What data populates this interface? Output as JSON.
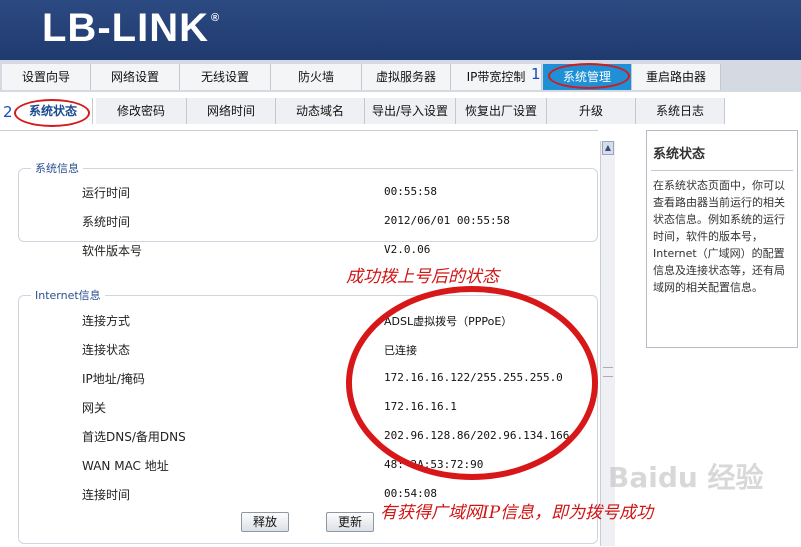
{
  "header": {
    "logo_text": "LB-LINK",
    "logo_mark": "®"
  },
  "top_nav": {
    "tabs": [
      "设置向导",
      "网络设置",
      "无线设置",
      "防火墙",
      "虚拟服务器",
      "IP带宽控制",
      "系统管理",
      "重启路由器"
    ],
    "active": "系统管理",
    "annotation_step": "1"
  },
  "sub_nav": {
    "tabs": [
      "系统状态",
      "修改密码",
      "网络时间",
      "动态域名",
      "导出/导入设置",
      "恢复出厂设置",
      "升级",
      "系统日志"
    ],
    "active": "系统状态",
    "annotation_step": "2"
  },
  "system_info": {
    "title": "系统信息",
    "rows": [
      {
        "label": "运行时间",
        "value": "00:55:58"
      },
      {
        "label": "系统时间",
        "value": "2012/06/01 00:55:58"
      },
      {
        "label": "软件版本号",
        "value": "V2.0.06"
      }
    ]
  },
  "internet_info": {
    "title": "Internet信息",
    "rows": [
      {
        "label": "连接方式",
        "value": "ADSL虚拟拨号（PPPoE）"
      },
      {
        "label": "连接状态",
        "value": "已连接"
      },
      {
        "label": "IP地址/掩码",
        "value": "172.16.16.122/255.255.255.0"
      },
      {
        "label": "网关",
        "value": "172.16.16.1"
      },
      {
        "label": "首选DNS/备用DNS",
        "value": "202.96.128.86/202.96.134.166"
      },
      {
        "label": "WAN MAC 地址",
        "value": "48:  2A:53:72:90"
      },
      {
        "label": "连接时间",
        "value": "00:54:08"
      }
    ],
    "release_button": "释放",
    "renew_button": "更新"
  },
  "help": {
    "title": "系统状态",
    "text": "在系统状态页面中，你可以查看路由器当前运行的相关状态信息。例如系统的运行时间，软件的版本号，Internet（广域网）的配置信息及连接状态等，还有局域网的相关配置信息。"
  },
  "annotations": {
    "status_note": "成功拨上号后的状态",
    "success_note": "有获得广域网IP信息，即为拨号成功"
  },
  "watermark": "Baidu 经验",
  "colors": {
    "header": "#1f3a6e",
    "active_tab": "#1f8fd6",
    "annotation": "#d01515"
  }
}
